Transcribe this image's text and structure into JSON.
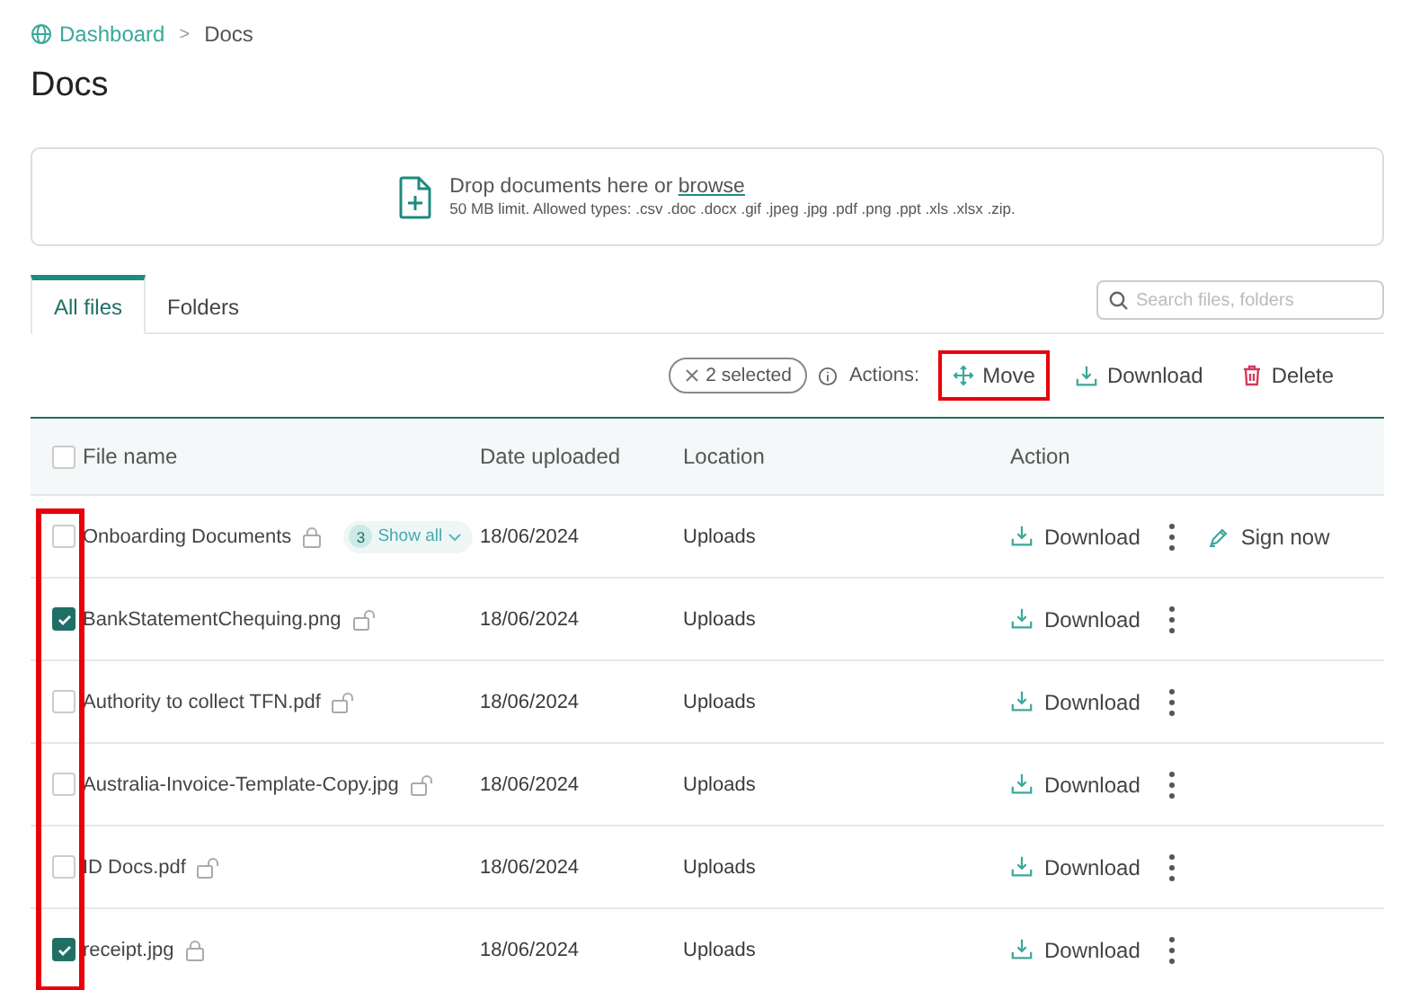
{
  "breadcrumb": [
    {
      "label": "Dashboard",
      "kind": "link"
    },
    {
      "label": "Docs",
      "kind": "current"
    }
  ],
  "breadcrumb_separator": ">",
  "title": "Docs",
  "dropzone": {
    "text": "Drop documents here or ",
    "link": "browse",
    "hint": "50 MB limit. Allowed types: .csv .doc .docx .gif .jpeg .jpg .pdf .png .ppt .xls .xlsx .zip."
  },
  "tabs": [
    {
      "label": "All files",
      "selected": true
    },
    {
      "label": "Folders",
      "selected": false
    }
  ],
  "search": {
    "placeholder": "Search files, folders"
  },
  "selection_chip": "2 selected",
  "actions_label": "Actions:",
  "actions": [
    {
      "label": "Move",
      "kind": "move",
      "highlighted": true
    },
    {
      "label": "Download",
      "kind": "download",
      "highlighted": false
    },
    {
      "label": "Delete",
      "kind": "delete",
      "highlighted": false
    }
  ],
  "table": {
    "checkbox_column_highlighted": true,
    "columns": [
      "File name",
      "Date uploaded",
      "Location",
      "Action"
    ],
    "header_checked": false,
    "rows": [
      {
        "name": "Onboarding Documents",
        "locked": true,
        "count": "3",
        "show_all": "Show all",
        "date": "18/06/2024",
        "location": "Uploads",
        "download": "Download",
        "sign": "Sign now",
        "checked": false
      },
      {
        "name": "BankStatementChequing.png",
        "locked": false,
        "date": "18/06/2024",
        "location": "Uploads",
        "download": "Download",
        "checked": true
      },
      {
        "name": "Authority to collect TFN.pdf",
        "locked": false,
        "date": "18/06/2024",
        "location": "Uploads",
        "download": "Download",
        "checked": false
      },
      {
        "name": "Australia-Invoice-Template-Copy.jpg",
        "locked": false,
        "date": "18/06/2024",
        "location": "Uploads",
        "download": "Download",
        "checked": false
      },
      {
        "name": "ID Docs.pdf",
        "locked": false,
        "date": "18/06/2024",
        "location": "Uploads",
        "download": "Download",
        "checked": false
      },
      {
        "name": "receipt.jpg",
        "locked": true,
        "date": "18/06/2024",
        "location": "Uploads",
        "download": "Download",
        "checked": true
      }
    ]
  }
}
